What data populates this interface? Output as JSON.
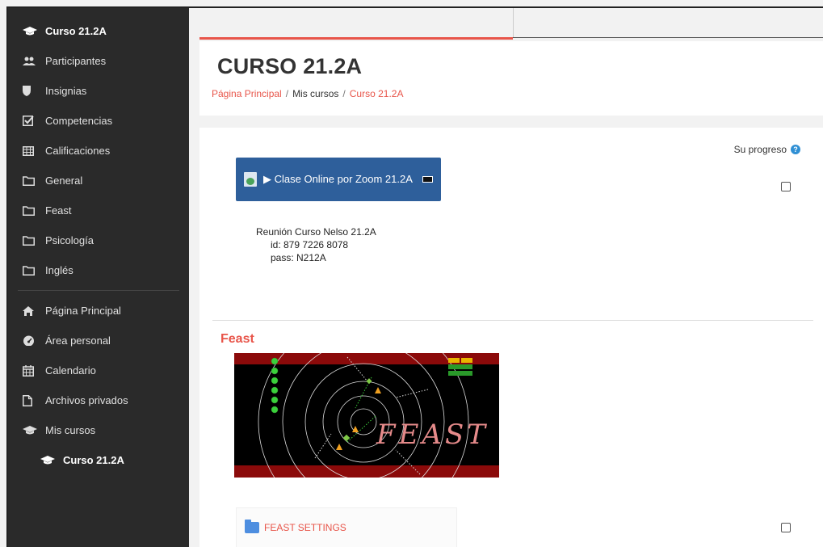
{
  "sidebar": {
    "course": "Curso 21.2A",
    "items": [
      {
        "label": "Participantes",
        "icon": "users-icon"
      },
      {
        "label": "Insignias",
        "icon": "shield-icon"
      },
      {
        "label": "Competencias",
        "icon": "checkbox-icon"
      },
      {
        "label": "Calificaciones",
        "icon": "table-icon"
      },
      {
        "label": "General",
        "icon": "folder-icon"
      },
      {
        "label": "Feast",
        "icon": "folder-icon"
      },
      {
        "label": "Psicología",
        "icon": "folder-icon"
      },
      {
        "label": "Inglés",
        "icon": "folder-icon"
      }
    ],
    "nav": [
      {
        "label": "Página Principal",
        "icon": "home-icon"
      },
      {
        "label": "Área personal",
        "icon": "dashboard-icon"
      },
      {
        "label": "Calendario",
        "icon": "calendar-icon"
      },
      {
        "label": "Archivos privados",
        "icon": "file-icon"
      },
      {
        "label": "Mis cursos",
        "icon": "graduation-cap-icon"
      }
    ],
    "current_course": "Curso 21.2A"
  },
  "header": {
    "title": "CURSO 21.2A",
    "breadcrumb": [
      "Página Principal",
      "Mis cursos",
      "Curso 21.2A"
    ]
  },
  "content": {
    "progress_label": "Su progreso",
    "help_glyph": "?",
    "zoom_button": "▶ Clase Online por Zoom 21.2A",
    "meeting": {
      "line1": "Reunión Curso Nelso 21.2A",
      "line2": "id: 879 7226 8078",
      "line3": "pass: N212A"
    },
    "section_title": "Feast",
    "image_text": "FEAST",
    "folder_label": "FEAST SETTINGS"
  },
  "colors": {
    "accent": "#e8554a",
    "sidebar_bg": "#2a2a2a",
    "zoom_button_bg": "#2e5f9b"
  }
}
